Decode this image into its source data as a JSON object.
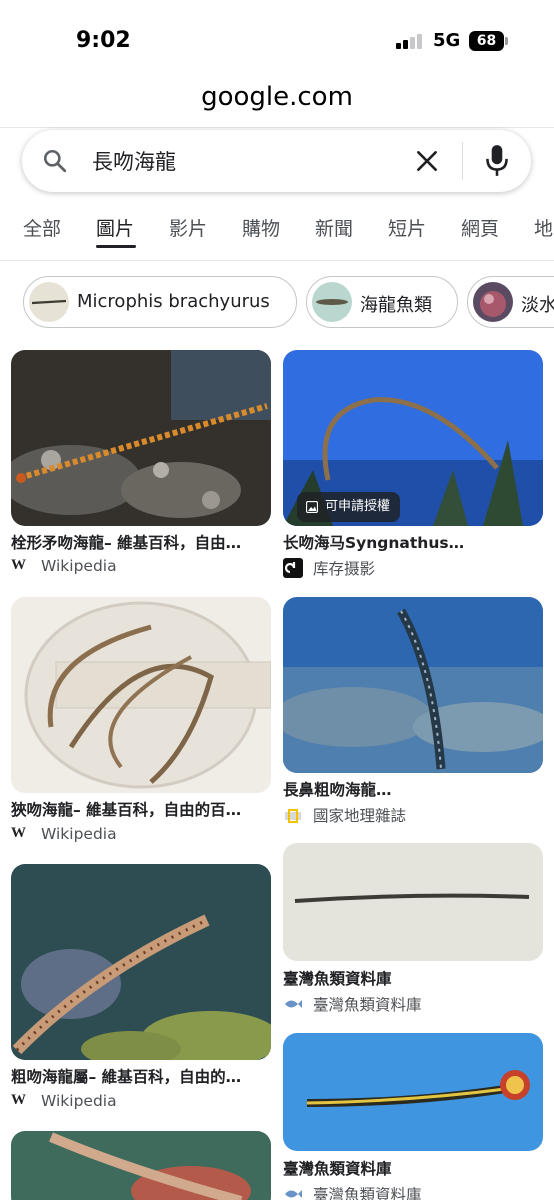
{
  "status": {
    "time": "9:02",
    "network": "5G",
    "battery": "68"
  },
  "browser": {
    "url": "google.com"
  },
  "search": {
    "query": "長吻海龍",
    "placeholder": ""
  },
  "tabs": [
    {
      "label": "全部"
    },
    {
      "label": "圖片",
      "active": true
    },
    {
      "label": "影片"
    },
    {
      "label": "購物"
    },
    {
      "label": "新聞"
    },
    {
      "label": "短片"
    },
    {
      "label": "網頁"
    },
    {
      "label": "地"
    }
  ],
  "chips": [
    {
      "label": "Microphis brachyurus"
    },
    {
      "label": "海龍魚類"
    },
    {
      "label": "淡水"
    }
  ],
  "results": [
    {
      "title": "栓形矛吻海龍– 維基百科，自由…",
      "source": "Wikipedia",
      "source_icon": "wikipedia-icon"
    },
    {
      "title": "长吻海马Syngnathus…",
      "source": "库存摄影",
      "source_icon": "dreamstime-icon",
      "badge": "可申請授權"
    },
    {
      "title": "狹吻海龍– 維基百科，自由的百…",
      "source": "Wikipedia",
      "source_icon": "wikipedia-icon"
    },
    {
      "title": "長鼻粗吻海龍…",
      "source": "國家地理雜誌",
      "source_icon": "natgeo-icon"
    },
    {
      "title": "臺灣魚類資料庫",
      "source": "臺灣魚類資料庫",
      "source_icon": "fishdb-icon"
    },
    {
      "title": "粗吻海龍屬– 維基百科，自由的…",
      "source": "Wikipedia",
      "source_icon": "wikipedia-icon"
    },
    {
      "title": "臺灣魚類資料庫",
      "source": "臺灣魚類資料庫",
      "source_icon": "fishdb-icon"
    }
  ]
}
